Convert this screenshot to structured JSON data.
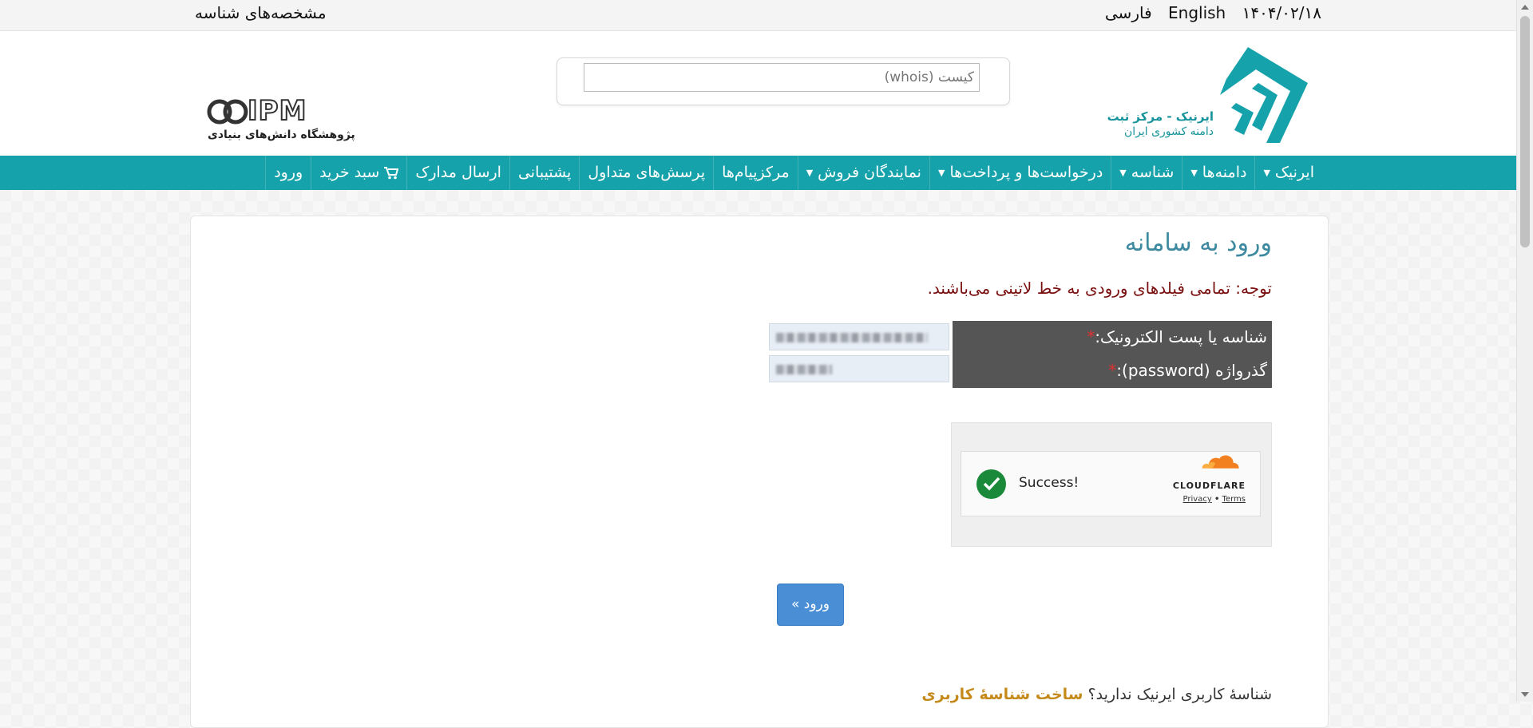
{
  "topbar": {
    "date": "۱۴۰۴/۰۲/۱۸",
    "lang_en": "English",
    "lang_fa": "فارسی",
    "profile_link": "مشخصه‌های شناسه"
  },
  "header": {
    "logo_title": "ایرنیک - مرکز ثبت",
    "logo_sub": "دامنه کشوری ایران",
    "whois_placeholder": "کیست (whois)",
    "ipm_text": "IPM",
    "ipm_sub": "پژوهشگاه دانش‌های بنیادی"
  },
  "nav": {
    "items": [
      {
        "label": "ایرنیک",
        "dropdown": true
      },
      {
        "label": "دامنه‌ها",
        "dropdown": true
      },
      {
        "label": "شناسه",
        "dropdown": true
      },
      {
        "label": "درخواست‌ها و پرداخت‌ها",
        "dropdown": true
      },
      {
        "label": "نمایندگان فروش",
        "dropdown": true
      },
      {
        "label": "مرکزپیام‌ها",
        "dropdown": false
      },
      {
        "label": "پرسش‌های متداول",
        "dropdown": false
      },
      {
        "label": "پشتیبانی",
        "dropdown": false
      },
      {
        "label": "ارسال مدارک",
        "dropdown": false
      },
      {
        "label": "سبد خرید",
        "dropdown": false,
        "icon": "cart-icon"
      },
      {
        "label": "ورود",
        "dropdown": false
      }
    ]
  },
  "login": {
    "title": "ورود به سامانه",
    "notice": "توجه: تمامی فیلدهای ورودی به خط لاتینی می‌باشند.",
    "username_label": "شناسه یا پست الکترونیک:",
    "password_label": "گذرواژه (password):",
    "required_mark": "*",
    "submit": "ورود »"
  },
  "captcha": {
    "status": "Success!",
    "brand": "CLOUDFLARE",
    "privacy": "Privacy",
    "sep": "•",
    "terms": "Terms"
  },
  "footer_note": {
    "text": "شناسهٔ کاربری ایرنیک ندارید؟",
    "link": "ساخت شناسهٔ کاربری"
  },
  "colors": {
    "nav_bg": "#16a2ab",
    "title": "#3d8aa0",
    "notice": "#7a0e0e",
    "button": "#4a8ed6"
  }
}
